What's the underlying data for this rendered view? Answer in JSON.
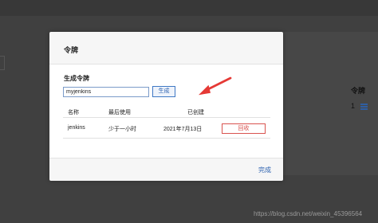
{
  "background": {
    "right_column_label": "令牌",
    "right_column_value": "1",
    "list_icon": "list-icon"
  },
  "modal": {
    "title": "令牌",
    "generate_label": "生成令牌",
    "token_input_value": "myjenkins",
    "generate_button": "生成",
    "table": {
      "headers": [
        "名称",
        "最后使用",
        "已创建"
      ],
      "rows": [
        {
          "name": "jenkins",
          "last_used": "少于一小时",
          "created": "2021年7月13日",
          "action": "回收"
        }
      ]
    },
    "done_button": "完成"
  },
  "annotation": {
    "arrow_color": "#e53935"
  },
  "watermark": "https://blog.csdn.net/weixin_45396564",
  "colors": {
    "link_blue": "#2e63b0",
    "danger_red": "#d9534f",
    "overlay": "#404040"
  }
}
